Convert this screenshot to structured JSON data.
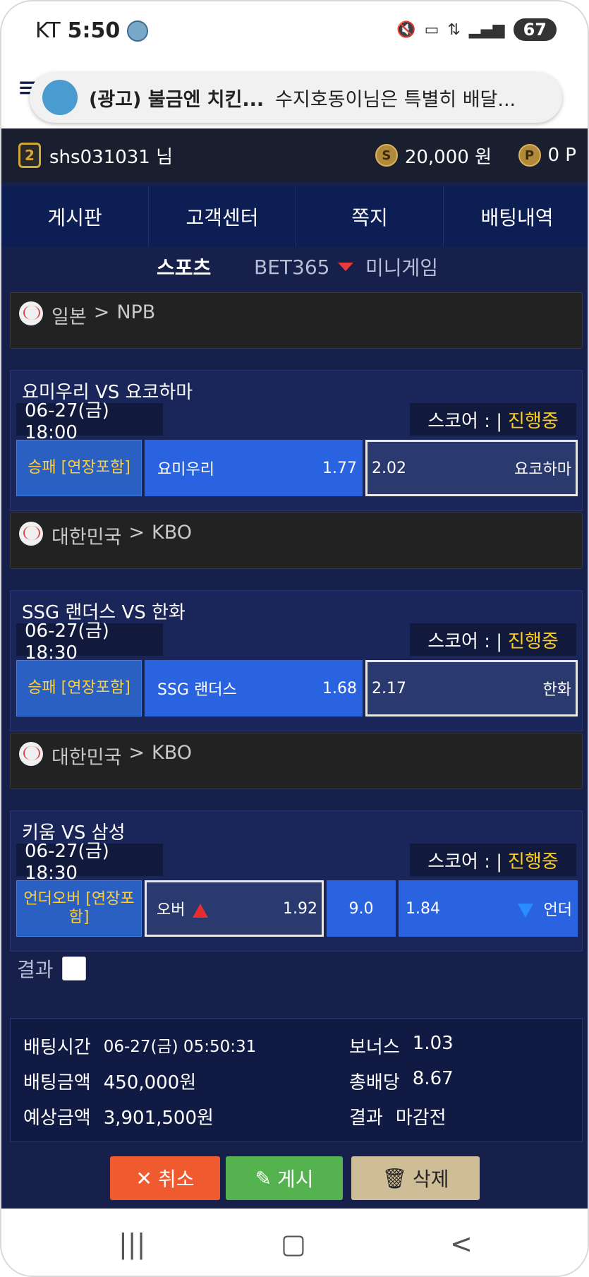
{
  "status_bar": {
    "carrier": "KT",
    "time": "5:50",
    "battery": "67",
    "icons": [
      "mute-icon",
      "hd-icon",
      "5g-icon",
      "signal-icon"
    ]
  },
  "ad": {
    "title": "(광고) 불금엔 치킨...",
    "text": "수지호동이님은 특별히 배달..."
  },
  "user": {
    "rank": "2",
    "name": "shs031031 님",
    "money": "20,000 원",
    "money_icon": "S",
    "point": "0 P",
    "point_icon": "P"
  },
  "nav": {
    "tabs": [
      "게시판",
      "고객센터",
      "쪽지",
      "배팅내역"
    ]
  },
  "subtabs": {
    "sports": "스포츠",
    "bet365": "BET365",
    "minigame": "미니게임"
  },
  "games": [
    {
      "league_country": "일본",
      "league_name": "NPB",
      "title": "요미우리 VS 요코하마",
      "date": "06-27(금) 18:00",
      "score_label": "스코어 : |",
      "status": "진행중",
      "bet_type": "승패 [연장포함]",
      "home": "요미우리",
      "home_odds": "1.77",
      "away_odds": "2.02",
      "away": "요코하마"
    },
    {
      "league_country": "대한민국",
      "league_name": "KBO",
      "title": "SSG 랜더스 VS 한화",
      "date": "06-27(금) 18:30",
      "score_label": "스코어 : |",
      "status": "진행중",
      "bet_type": "승패 [연장포함]",
      "home": "SSG 랜더스",
      "home_odds": "1.68",
      "away_odds": "2.17",
      "away": "한화"
    },
    {
      "league_country": "대한민국",
      "league_name": "KBO",
      "title": "키움 VS 삼성",
      "date": "06-27(금) 18:30",
      "score_label": "스코어 : |",
      "status": "진행중",
      "bet_type": "언더오버 [연장포함]",
      "over_label": "오버",
      "over_odds": "1.92",
      "line": "9.0",
      "under_odds": "1.84",
      "under_label": "언더"
    }
  ],
  "result": {
    "label": "결과"
  },
  "summary": {
    "bet_time_label": "배팅시간",
    "bet_time": "06-27(금) 05:50:31",
    "bet_amount_label": "배팅금액",
    "bet_amount": "450,000원",
    "expected_label": "예상금액",
    "expected": "3,901,500원",
    "bonus_label": "보너스",
    "bonus": "1.03",
    "total_odds_label": "총배당",
    "total_odds": "8.67",
    "result_label": "결과",
    "result": "마감전"
  },
  "actions": {
    "cancel": "취소",
    "post": "게시",
    "delete": "삭제"
  },
  "colors": {
    "background": "#16204a",
    "status_live": "#ffcc1a",
    "bet_blue": "#2a63e0",
    "cancel": "#ef5b2e",
    "post": "#54b24f",
    "delete": "#cfbd98"
  }
}
